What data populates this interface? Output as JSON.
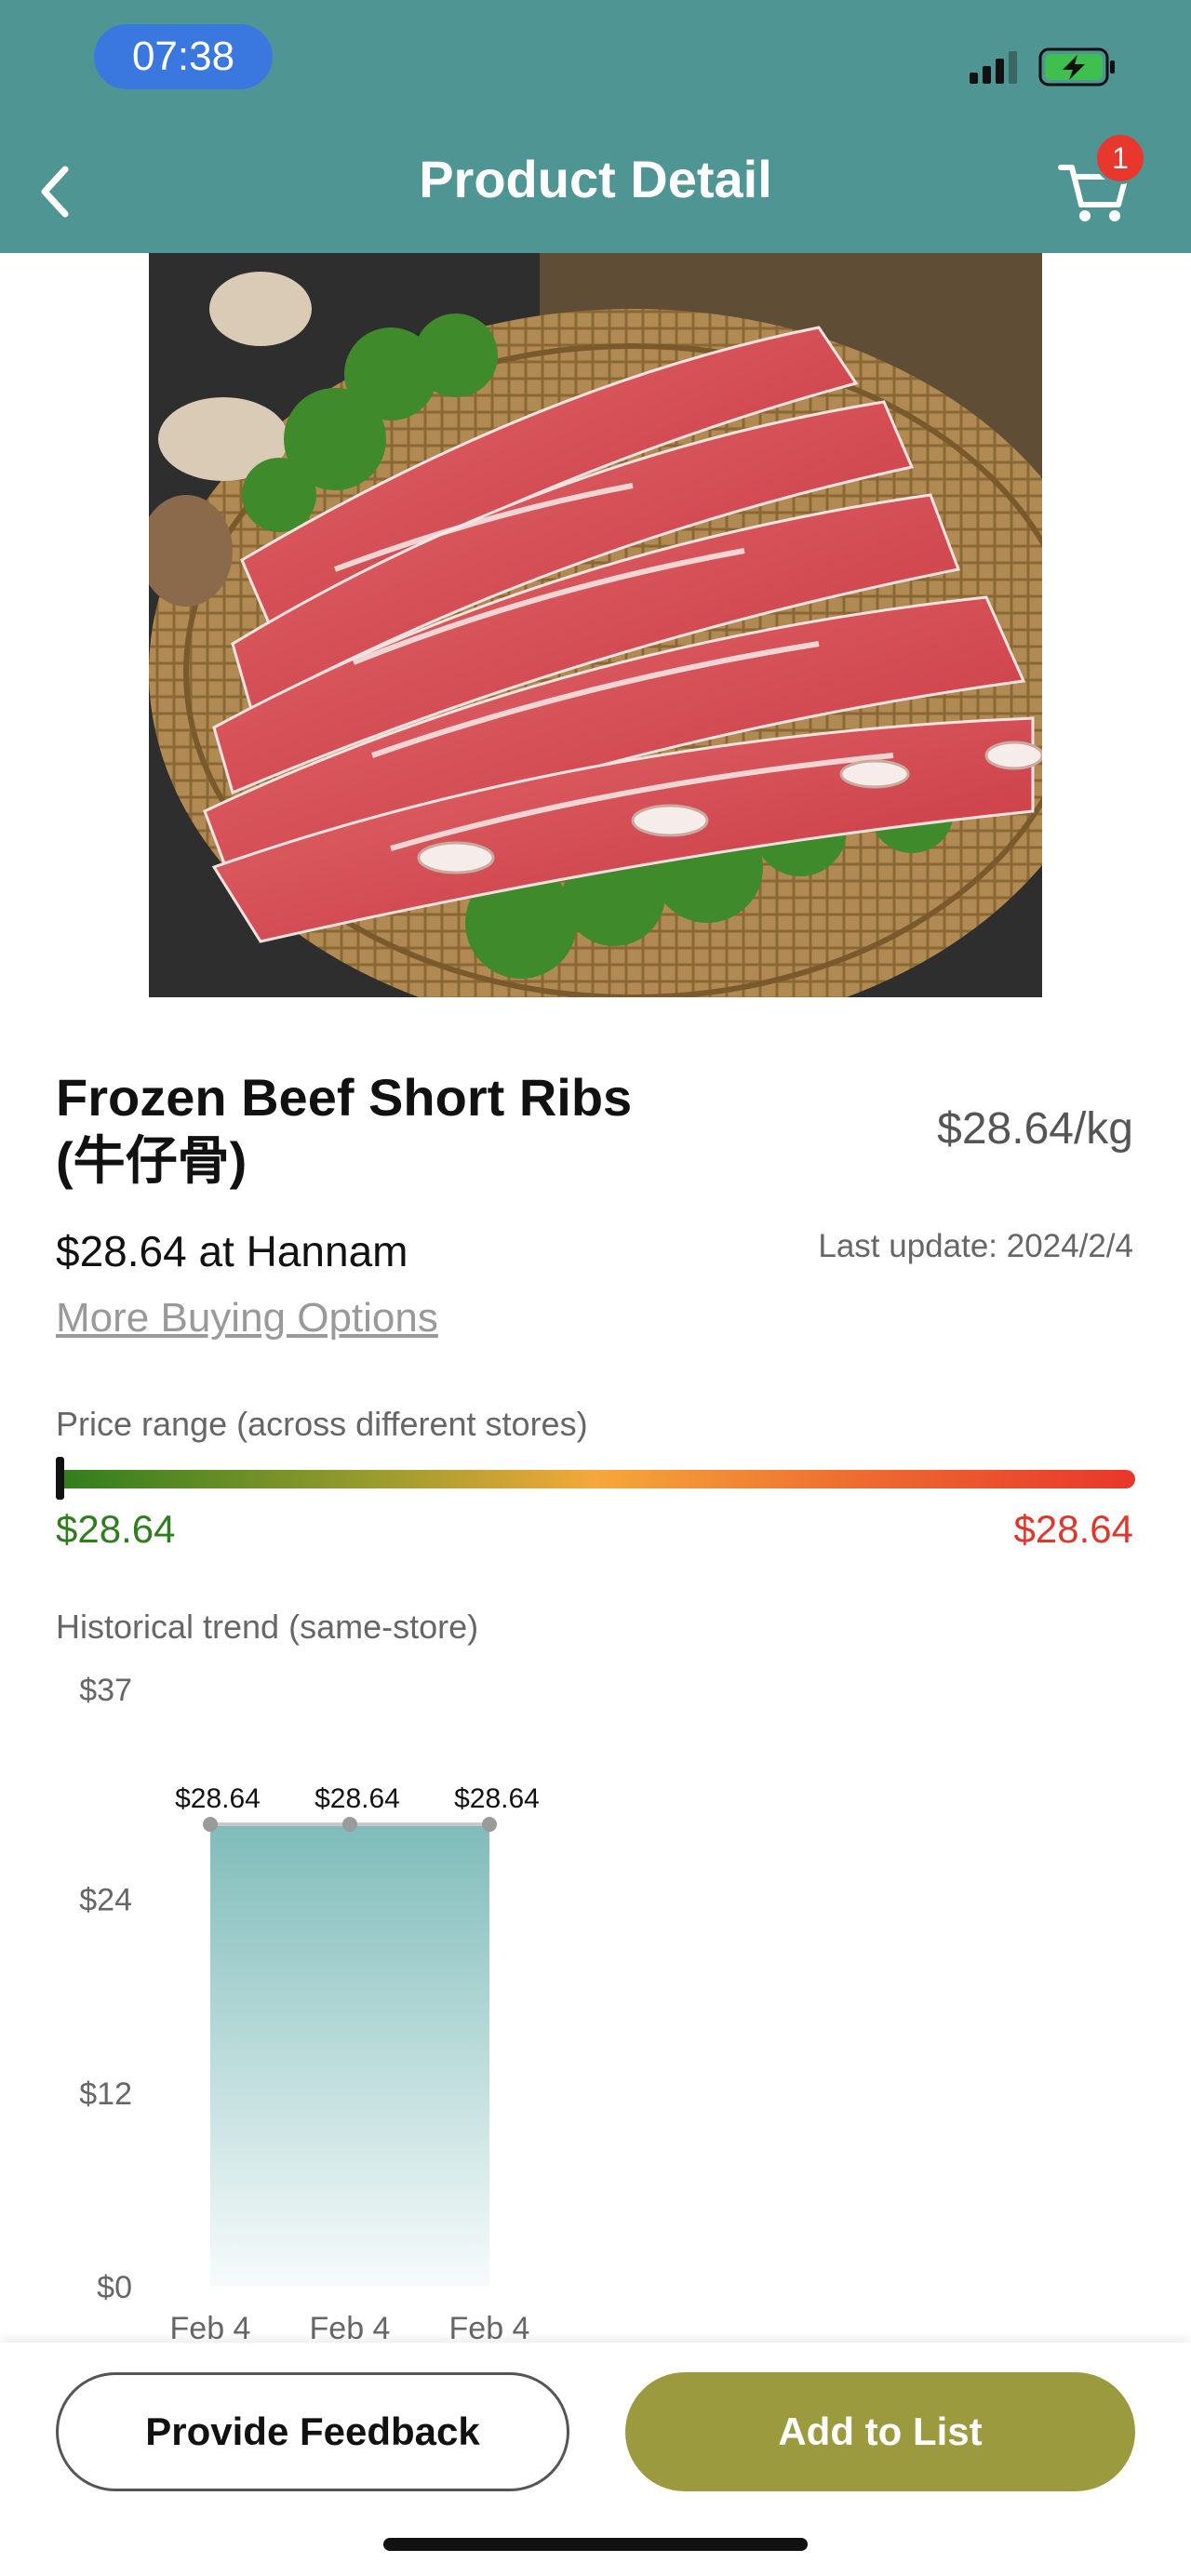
{
  "status_bar": {
    "time": "07:38"
  },
  "header": {
    "title": "Product Detail",
    "cart_count": "1"
  },
  "product": {
    "name_line1": "Frozen Beef Short Ribs",
    "name_line2": "(牛仔骨)",
    "unit_price": "$28.64/kg",
    "store_price": "$28.64 at Hannam",
    "last_update": "Last update: 2024/2/4",
    "more_options": "More Buying Options"
  },
  "price_range": {
    "label": "Price range (across different stores)",
    "min": "$28.64",
    "max": "$28.64",
    "position_fraction": 0
  },
  "trend": {
    "label": "Historical trend (same-store)"
  },
  "chart_data": {
    "type": "area",
    "title": "",
    "xlabel": "",
    "ylabel": "",
    "categories": [
      "Feb 4",
      "Feb 4",
      "Feb 4"
    ],
    "values": [
      28.64,
      28.64,
      28.64
    ],
    "data_labels": [
      "$28.64",
      "$28.64",
      "$28.64"
    ],
    "y_ticks": [
      "$0",
      "$12",
      "$24",
      "$37"
    ],
    "y_tick_values": [
      0,
      12,
      24,
      37
    ],
    "ylim": [
      0,
      37
    ],
    "grid": false,
    "colors": {
      "fill": "#7fbcba",
      "line": "#c8c8c8",
      "point": "#9a9a9a"
    }
  },
  "actions": {
    "feedback": "Provide Feedback",
    "add": "Add to List"
  },
  "colors": {
    "header": "#4f9593",
    "add_button": "#9b9a3e",
    "badge": "#e8372c"
  }
}
